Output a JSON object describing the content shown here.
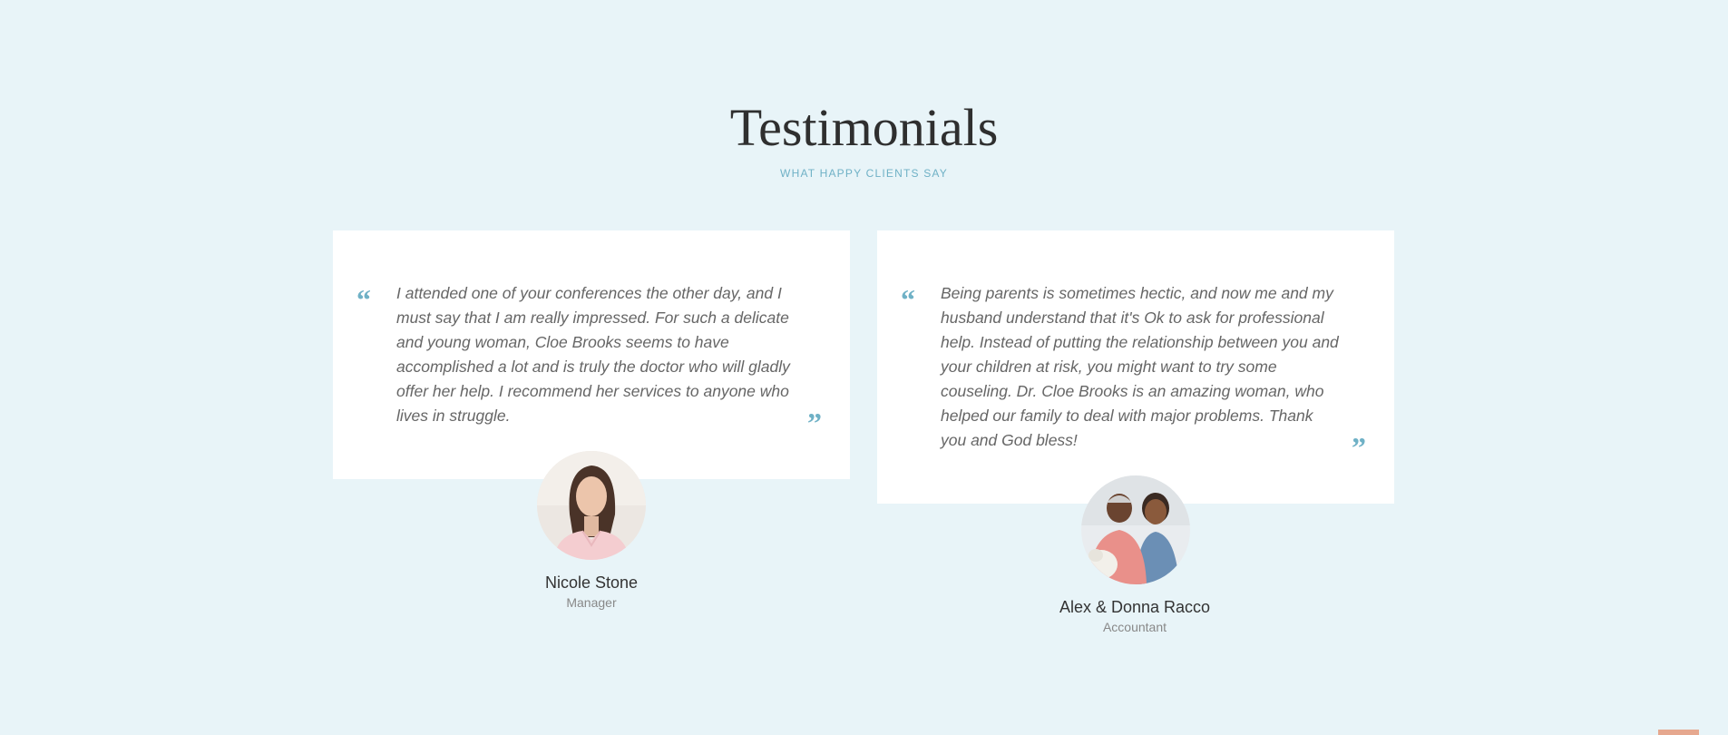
{
  "section": {
    "title": "Testimonials",
    "subtitle": "WHAT HAPPY CLIENTS SAY"
  },
  "testimonials": [
    {
      "quote": "I attended one of your conferences the other day, and I must say that I am really impressed. For such a delicate and young woman, Cloe Brooks seems to have accomplished a lot and is truly the doctor who will gladly offer her help. I recommend her services to anyone who lives in struggle.",
      "name": "Nicole Stone",
      "role": "Manager"
    },
    {
      "quote": "Being parents is sometimes hectic, and now me and my husband understand that it's Ok to ask for professional help. Instead of putting the relationship between you and your children at risk, you might want to try some couseling. Dr. Cloe Brooks is an amazing woman, who helped our family to deal with major problems. Thank you and God bless!",
      "name": "Alex & Donna Racco",
      "role": "Accountant"
    }
  ],
  "quote_marks": {
    "open": "“",
    "close": "”"
  },
  "colors": {
    "background": "#e8f4f8",
    "accent": "#6fb1c6",
    "card": "#ffffff",
    "scroll_button": "#e6a88f"
  }
}
